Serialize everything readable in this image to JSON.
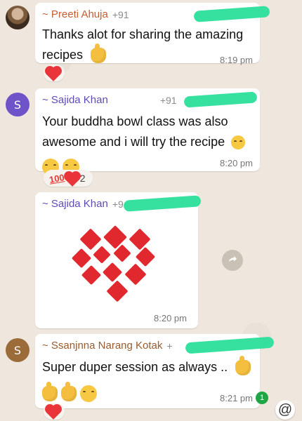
{
  "messages": [
    {
      "sender": "~ Preeti Ahuja",
      "phone": "+91",
      "text": "Thanks alot for sharing the amazing recipes",
      "time": "8:19 pm"
    },
    {
      "sender": "~ Sajida Khan",
      "phone": "+91",
      "text": "Your buddha bowl class was also awesome and i will try the recipe",
      "time": "8:20 pm",
      "reaction_count": "2",
      "avatar_letter": "S"
    },
    {
      "sender": "~ Sajida Khan",
      "phone": "+9",
      "time": "8:20 pm"
    },
    {
      "sender": "~ Ssanjnna Narang Kotak",
      "phone": "+",
      "text": "Super duper session as always ..",
      "time": "8:21 pm",
      "avatar_letter": "S"
    }
  ],
  "ui": {
    "unread_count": "1",
    "mention_symbol": "@",
    "hundred_label": "100"
  }
}
